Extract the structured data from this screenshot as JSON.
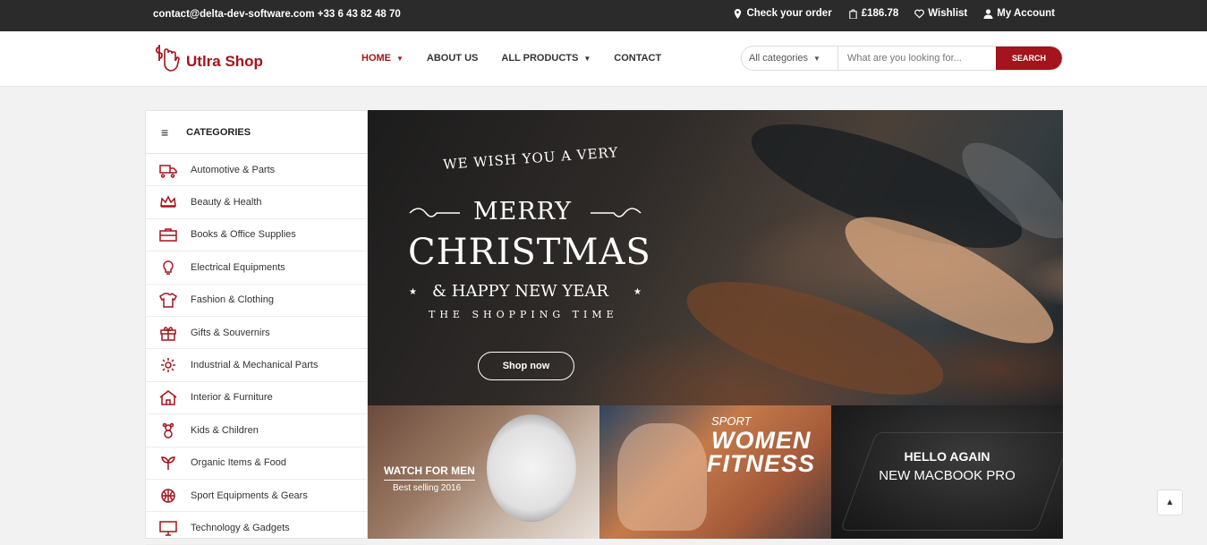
{
  "topbar": {
    "contact": "contact@delta-dev-software.com +33 6 43 82 48 70",
    "check_order": "Check your order",
    "cart_total": "£186.78",
    "wishlist": "Wishlist",
    "account": "My Account"
  },
  "header": {
    "brand": "Utlra Shop",
    "nav": [
      {
        "label": "HOME",
        "dropdown": true
      },
      {
        "label": "ABOUT US",
        "dropdown": false
      },
      {
        "label": "ALL PRODUCTS",
        "dropdown": true
      },
      {
        "label": "CONTACT",
        "dropdown": false
      }
    ],
    "search": {
      "category": "All categories",
      "placeholder": "What are you looking for...",
      "button": "SEARCH"
    },
    "accent_color": "#a3141c"
  },
  "sidebar": {
    "title": "CATEGORIES",
    "items": [
      {
        "label": "Automotive & Parts",
        "icon": "truck-icon"
      },
      {
        "label": "Beauty & Health",
        "icon": "crown-icon"
      },
      {
        "label": "Books & Office Supplies",
        "icon": "briefcase-icon"
      },
      {
        "label": "Electrical Equipments",
        "icon": "bulb-icon"
      },
      {
        "label": "Fashion & Clothing",
        "icon": "tshirt-icon"
      },
      {
        "label": "Gifts & Souvernirs",
        "icon": "gift-icon"
      },
      {
        "label": "Industrial & Mechanical Parts",
        "icon": "gear-icon"
      },
      {
        "label": "Interior & Furniture",
        "icon": "home-icon"
      },
      {
        "label": "Kids & Children",
        "icon": "teddy-icon"
      },
      {
        "label": "Organic Items & Food",
        "icon": "sprout-icon"
      },
      {
        "label": "Sport Equipments & Gears",
        "icon": "ball-icon"
      },
      {
        "label": "Technology & Gadgets",
        "icon": "monitor-icon"
      }
    ]
  },
  "banner": {
    "line1": "WE WISH YOU A VERY",
    "line2": "MERRY",
    "line3": "CHRISTMAS",
    "line4": "& HAPPY NEW YEAR",
    "line5": "THE SHOPPING TIME",
    "button": "Shop now"
  },
  "tiles": {
    "watch": {
      "title": "WATCH FOR MEN",
      "subtitle": "Best selling 2016"
    },
    "fitness": {
      "small": "SPORT",
      "line1": "WOMEN",
      "line2": "FITNESS"
    },
    "macbook": {
      "line1": "HELLO AGAIN",
      "line2": "NEW MACBOOK PRO"
    }
  },
  "scroll_top_icon": "chevron-up-icon"
}
